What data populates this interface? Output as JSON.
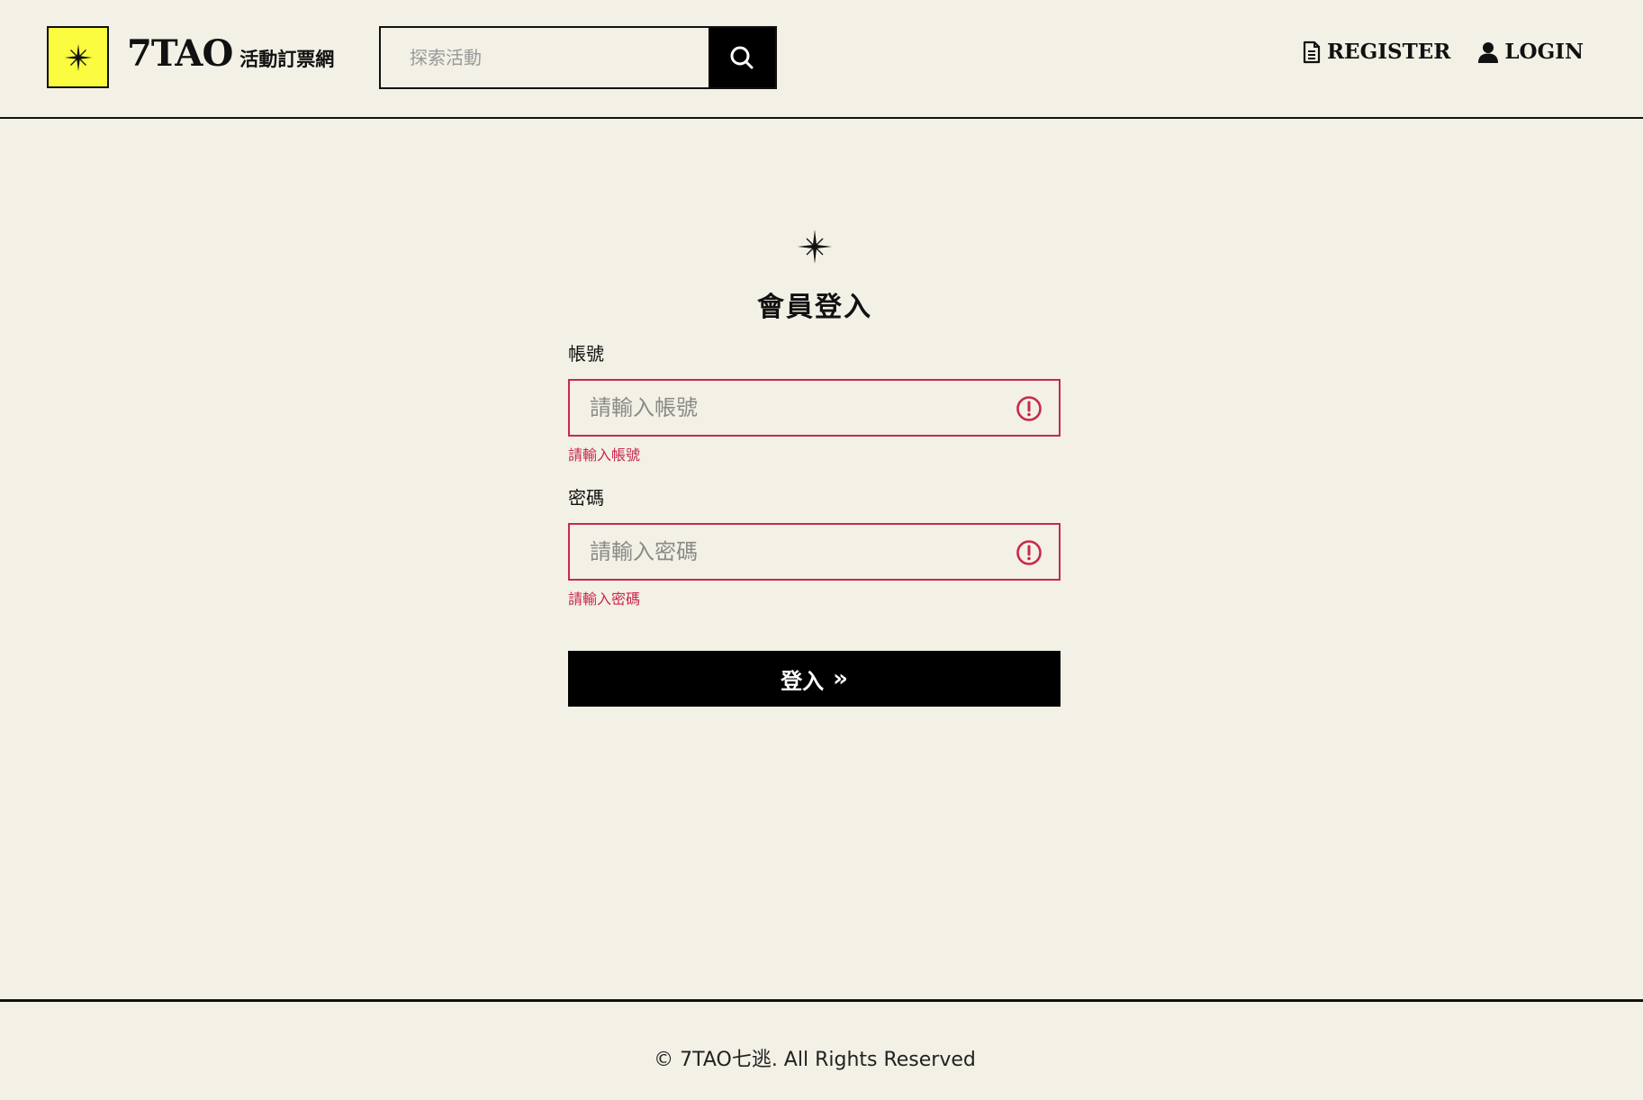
{
  "header": {
    "brand_name": "7TAO",
    "brand_subtitle": "活動訂票網",
    "search": {
      "placeholder": "探索活動",
      "value": ""
    },
    "nav": {
      "register_label": "REGISTER",
      "login_label": "LOGIN"
    }
  },
  "login": {
    "title": "會員登入",
    "account": {
      "label": "帳號",
      "placeholder": "請輸入帳號",
      "value": "",
      "error": "請輸入帳號"
    },
    "password": {
      "label": "密碼",
      "placeholder": "請輸入密碼",
      "value": "",
      "error": "請輸入密碼"
    },
    "submit_label": "登入",
    "submit_arrow": "»"
  },
  "footer": {
    "copyright": "© 7TAO七逃. All Rights Reserved"
  },
  "icons": {
    "logo": "four-point-star-icon",
    "search": "search-icon",
    "register": "document-icon",
    "login": "user-icon",
    "field_error": "exclamation-circle-icon"
  },
  "colors": {
    "background": "#f3f0e5",
    "logo_yellow": "#fbfb3f",
    "error": "#c8294a",
    "primary": "#000000"
  }
}
